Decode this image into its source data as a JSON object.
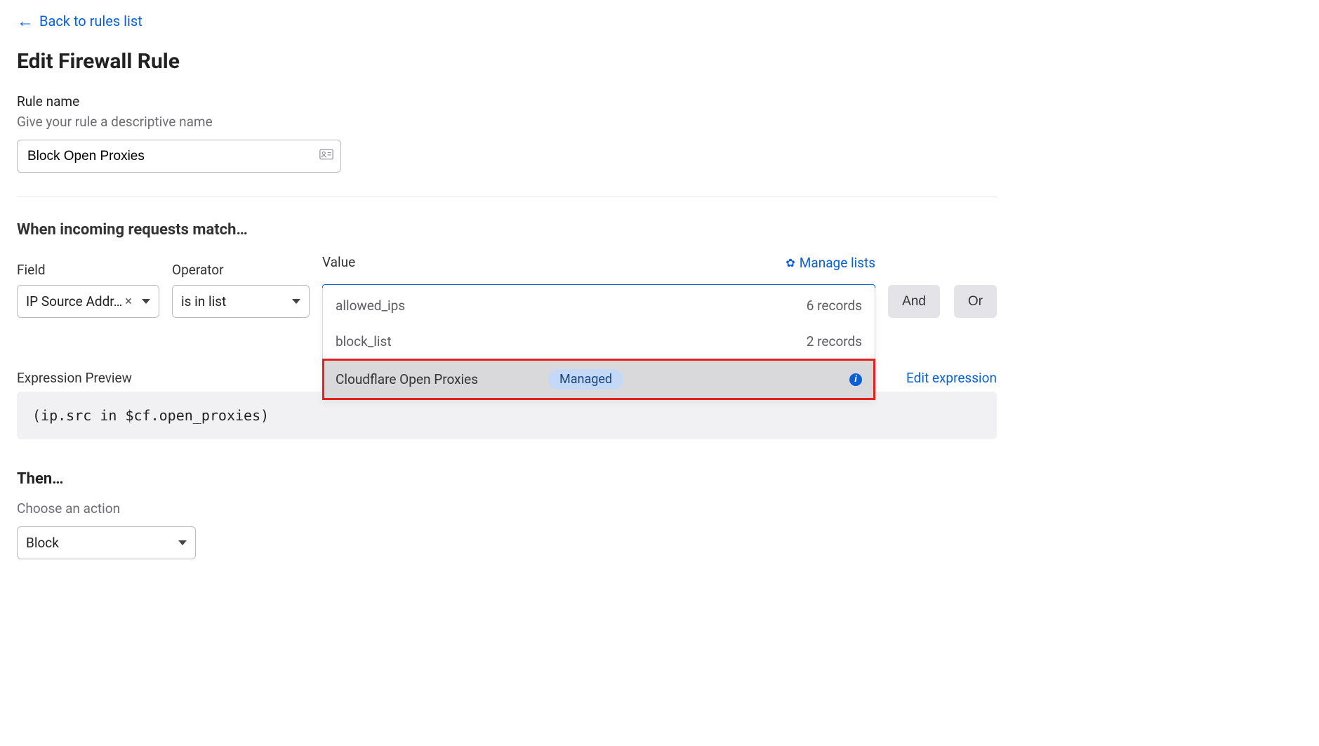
{
  "nav": {
    "back_label": "Back to rules list"
  },
  "page": {
    "title": "Edit Firewall Rule"
  },
  "rule_name": {
    "label": "Rule name",
    "hint": "Give your rule a descriptive name",
    "value": "Block Open Proxies"
  },
  "match": {
    "title": "When incoming requests match…",
    "field_label": "Field",
    "operator_label": "Operator",
    "value_label": "Value",
    "field_value": "IP Source Addr…",
    "operator_value": "is in list",
    "manage_lists_label": "Manage lists",
    "selected_value_name": "Cloudflare Open Proxies",
    "selected_value_badge": "Managed",
    "options": [
      {
        "name": "allowed_ips",
        "meta": "6 records",
        "managed": false,
        "highlighted": false
      },
      {
        "name": "block_list",
        "meta": "2 records",
        "managed": false,
        "highlighted": false
      },
      {
        "name": "Cloudflare Open Proxies",
        "meta": "",
        "managed": true,
        "highlighted": true
      }
    ],
    "and_label": "And",
    "or_label": "Or"
  },
  "expression": {
    "label": "Expression Preview",
    "edit_label": "Edit expression",
    "value": "(ip.src in $cf.open_proxies)"
  },
  "then": {
    "title": "Then…",
    "hint": "Choose an action",
    "action_value": "Block"
  }
}
